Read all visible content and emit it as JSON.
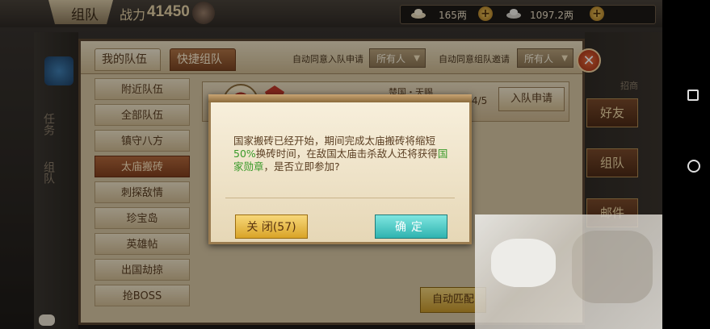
{
  "topbar": {
    "team_title": "组队",
    "power_label": "战力",
    "power_value": "41450",
    "silver": "165两",
    "gold": "1097.2两",
    "plus": "+"
  },
  "hud": {
    "left_text_1": "任务",
    "left_text_2": "组队",
    "right_btn_1": "好友",
    "right_btn_2": "组队",
    "right_btn_3": "邮件",
    "right_text_top": "招商"
  },
  "panel": {
    "tab_my_team": "我的队伍",
    "tab_quick_team": "快捷组队",
    "auto_join_label": "自动同意入队申请",
    "auto_join_value": "所有人",
    "auto_invite_label": "自动同意组队邀请",
    "auto_invite_value": "所有人",
    "close_symbol": "✕",
    "categories": [
      {
        "label": "附近队伍"
      },
      {
        "label": "全部队伍"
      },
      {
        "label": "镇守八方"
      },
      {
        "label": "太庙搬砖"
      },
      {
        "label": "刺探敌情"
      },
      {
        "label": "珍宝岛"
      },
      {
        "label": "英雄帖"
      },
      {
        "label": "出国劫掠"
      },
      {
        "label": "抢BOSS"
      }
    ],
    "team_row": {
      "name": "楚国・天赐",
      "count": "4/5",
      "apply_label": "入队申请"
    },
    "auto_match_label": "自动匹配"
  },
  "dialog": {
    "msg_part1": "国家搬砖已经开始，期间完成太庙搬砖将缩短",
    "msg_highlight1": "50%",
    "msg_part2": "换砖时间，在敌国太庙击杀敌人还将获得",
    "msg_highlight2": "国家勋章",
    "msg_part3": "，是否立即参加?",
    "close_label": "关 闭(57)",
    "ok_label": "确定"
  },
  "colors": {
    "highlight_green": "#3a9a2a",
    "ok_teal": "#2fb3b0",
    "close_gold": "#d9a428"
  }
}
